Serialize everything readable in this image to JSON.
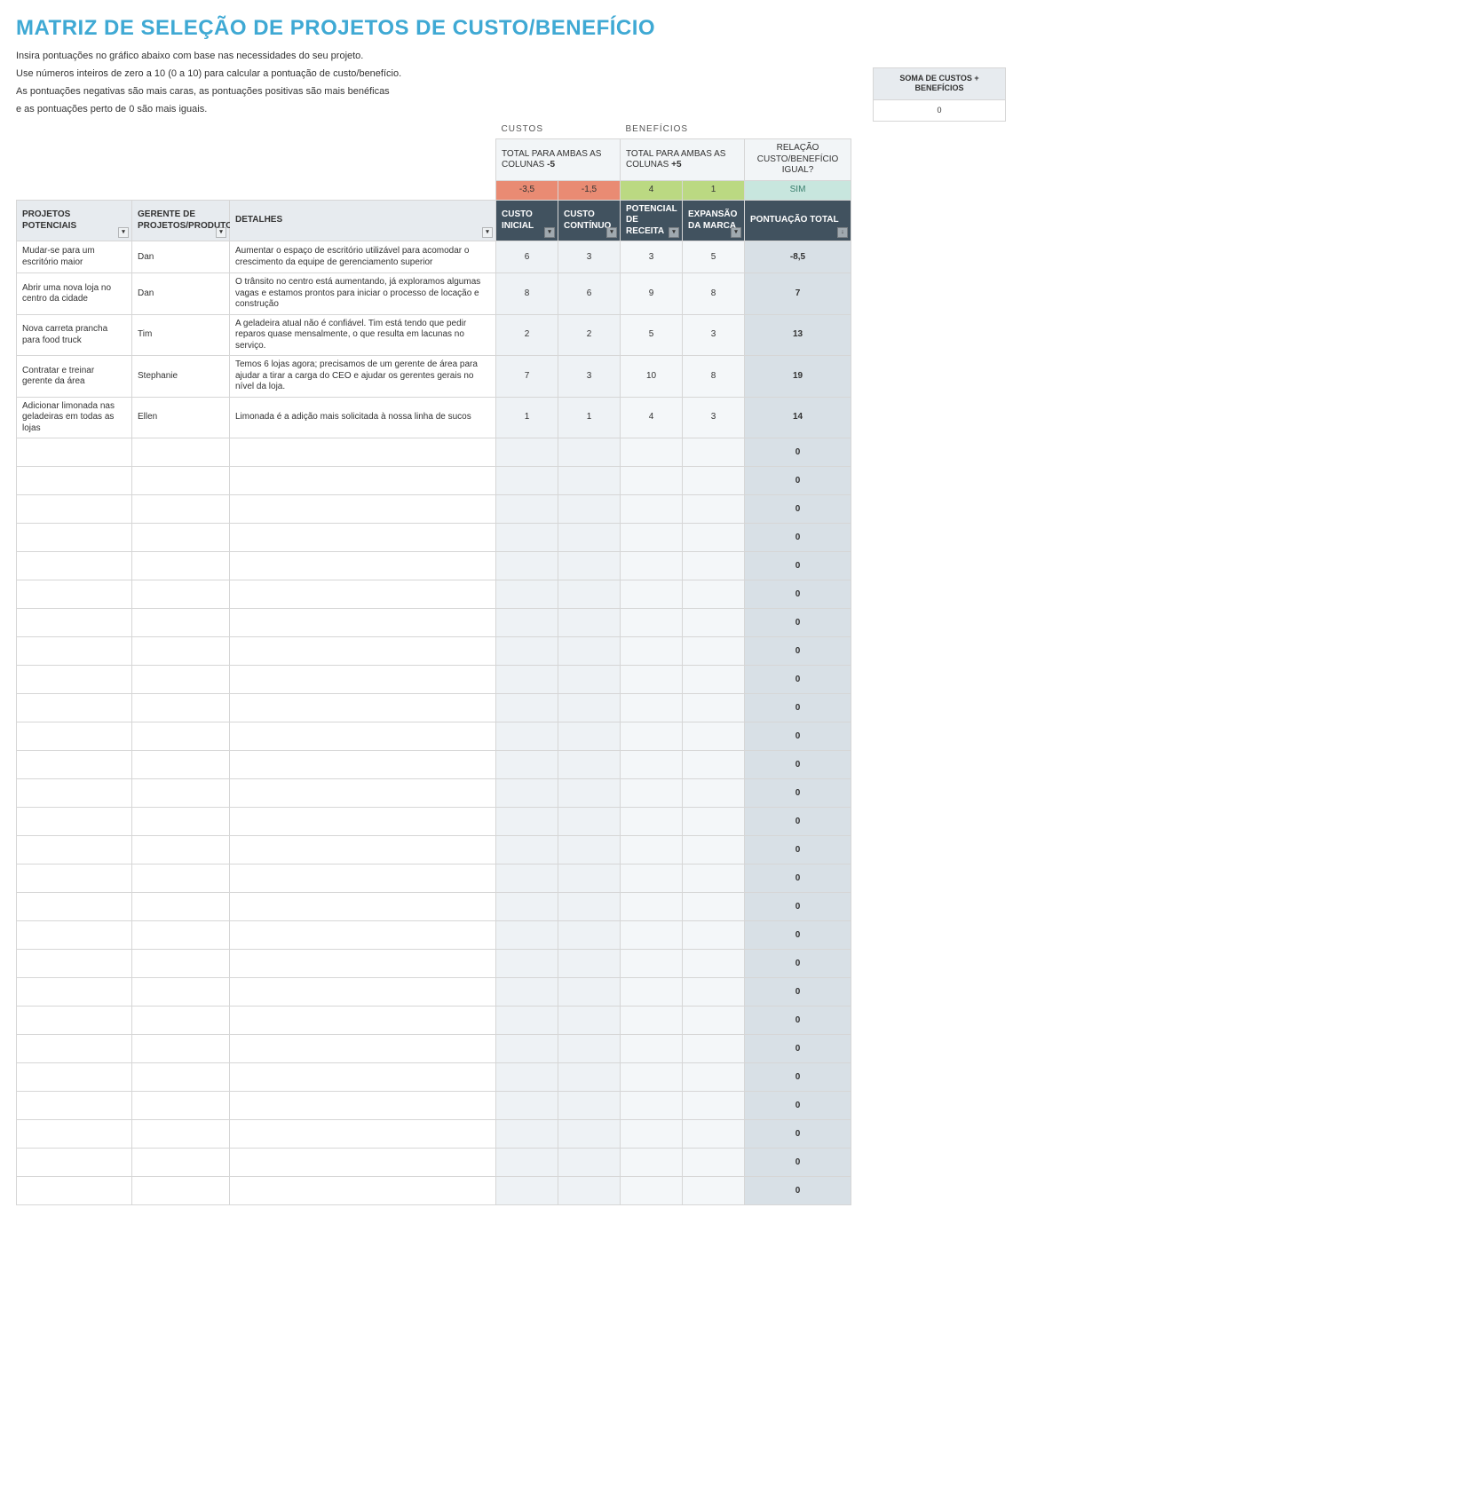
{
  "title": "MATRIZ DE SELEÇÃO DE PROJETOS DE CUSTO/BENEFÍCIO",
  "intro": [
    "Insira pontuações no gráfico abaixo com base nas necessidades do seu projeto.",
    "Use números inteiros de zero a 10 (0 a 10) para calcular a pontuação de custo/benefício.",
    "As pontuações negativas são mais caras, as pontuações positivas são mais benéficas",
    "e as pontuações perto de 0 são mais iguais."
  ],
  "sections": {
    "costs_label": "CUSTOS",
    "benefits_label": "BENEFÍCIOS"
  },
  "totals": {
    "costs_prefix": "TOTAL PARA AMBAS AS COLUNAS ",
    "costs_value": "-5",
    "benefits_prefix": "TOTAL PARA AMBAS AS COLUNAS ",
    "benefits_value": "+5",
    "equal_question": "RELAÇÃO CUSTO/BENEFÍCIO IGUAL?",
    "equal_answer": "SIM"
  },
  "weights": {
    "cost_initial": "-3,5",
    "cost_ongoing": "-1,5",
    "benefit_revenue": "4",
    "benefit_brand": "1"
  },
  "headers": {
    "project": "PROJETOS POTENCIAIS",
    "manager": "GERENTE DE PROJETOS/PRODUTOS",
    "details": "DETALHES",
    "cost_initial": "CUSTO INICIAL",
    "cost_ongoing": "CUSTO CONTÍNUO",
    "benefit_revenue": "POTENCIAL DE RECEITA",
    "benefit_brand": "EXPANSÃO DA MARCA",
    "score_total": "PONTUAÇÃO TOTAL"
  },
  "rows": [
    {
      "project": "Mudar-se para um escritório maior",
      "manager": "Dan",
      "details": "Aumentar o espaço de escritório utilizável para acomodar o crescimento da equipe de gerenciamento superior",
      "c1": "6",
      "c2": "3",
      "b1": "3",
      "b2": "5",
      "total": "-8,5"
    },
    {
      "project": "Abrir uma nova loja no centro da cidade",
      "manager": "Dan",
      "details": "O trânsito no centro está aumentando, já exploramos algumas vagas e estamos prontos para iniciar o processo de locação e construção",
      "c1": "8",
      "c2": "6",
      "b1": "9",
      "b2": "8",
      "total": "7"
    },
    {
      "project": "Nova carreta prancha para food truck",
      "manager": "Tim",
      "details": "A geladeira atual não é confiável. Tim está tendo que pedir reparos quase mensalmente, o que resulta em lacunas no serviço.",
      "c1": "2",
      "c2": "2",
      "b1": "5",
      "b2": "3",
      "total": "13"
    },
    {
      "project": "Contratar e treinar gerente da área",
      "manager": "Stephanie",
      "details": "Temos 6 lojas agora; precisamos de um gerente de área para ajudar a tirar a carga do CEO e ajudar os gerentes gerais no nível da loja.",
      "c1": "7",
      "c2": "3",
      "b1": "10",
      "b2": "8",
      "total": "19"
    },
    {
      "project": "Adicionar limonada nas geladeiras em todas as lojas",
      "manager": "Ellen",
      "details": "Limonada é a adição mais solicitada à nossa linha de sucos",
      "c1": "1",
      "c2": "1",
      "b1": "4",
      "b2": "3",
      "total": "14"
    }
  ],
  "empty_total": "0",
  "empty_row_count": 27,
  "summary": {
    "label": "SOMA DE CUSTOS + BENEFÍCIOS",
    "value": "0"
  }
}
